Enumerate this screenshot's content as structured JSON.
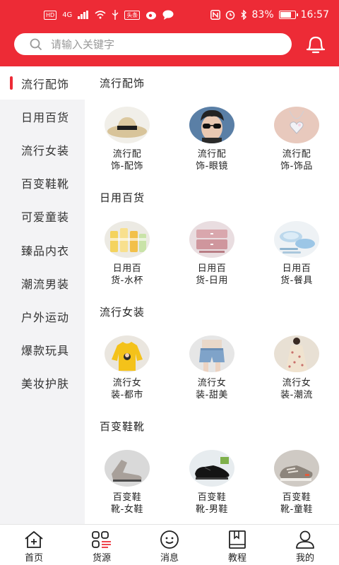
{
  "status_bar": {
    "network": "HD",
    "signal_label": "4G",
    "battery_percent": "83%",
    "battery_level": 0.83,
    "time": "16:57",
    "icons": [
      "wifi-icon",
      "usb-icon",
      "toutiao-icon",
      "weibo-icon",
      "message-icon",
      "nfc-icon",
      "alarm-icon",
      "bluetooth-icon",
      "battery-icon"
    ]
  },
  "search": {
    "placeholder": "请输入关键字"
  },
  "colors": {
    "brand": "#ed2b36",
    "sidebar_bg": "#f3f3f5"
  },
  "sidebar": {
    "items": [
      {
        "label": "流行配饰",
        "active": true
      },
      {
        "label": "日用百货"
      },
      {
        "label": "流行女装"
      },
      {
        "label": "百变鞋靴"
      },
      {
        "label": "可爱童装"
      },
      {
        "label": "臻品内衣"
      },
      {
        "label": "潮流男装"
      },
      {
        "label": "户外运动"
      },
      {
        "label": "爆款玩具"
      },
      {
        "label": "美妆护肤"
      }
    ]
  },
  "sections": [
    {
      "title": "流行配饰",
      "items": [
        {
          "line1": "流行配",
          "line2": "饰-配饰",
          "image": "straw-hat"
        },
        {
          "line1": "流行配",
          "line2": "饰-眼镜",
          "image": "sunglasses-model"
        },
        {
          "line1": "流行配",
          "line2": "饰-饰品",
          "image": "heart-necklace"
        }
      ]
    },
    {
      "title": "日用百货",
      "items": [
        {
          "line1": "日用百",
          "line2": "货-水杯",
          "image": "drink-cups"
        },
        {
          "line1": "日用百",
          "line2": "货-日用",
          "image": "storage-box"
        },
        {
          "line1": "日用百",
          "line2": "货-餐具",
          "image": "dish-set"
        }
      ]
    },
    {
      "title": "流行女装",
      "items": [
        {
          "line1": "流行女",
          "line2": "装-都市",
          "image": "yellow-hoodie"
        },
        {
          "line1": "流行女",
          "line2": "装-甜美",
          "image": "denim-shorts"
        },
        {
          "line1": "流行女",
          "line2": "装-潮流",
          "image": "floral-dress"
        }
      ]
    },
    {
      "title": "百变鞋靴",
      "items": [
        {
          "line1": "百变鞋",
          "line2": "靴-女鞋",
          "image": "women-boots"
        },
        {
          "line1": "百变鞋",
          "line2": "靴-男鞋",
          "image": "men-leather-shoes"
        },
        {
          "line1": "百变鞋",
          "line2": "靴-童鞋",
          "image": "kids-sneakers"
        }
      ]
    }
  ],
  "bottom_nav": [
    {
      "label": "首页",
      "icon": "home-icon"
    },
    {
      "label": "货源",
      "icon": "grid-list-icon"
    },
    {
      "label": "消息",
      "icon": "smile-message-icon"
    },
    {
      "label": "教程",
      "icon": "book-icon"
    },
    {
      "label": "我的",
      "icon": "user-icon"
    }
  ]
}
